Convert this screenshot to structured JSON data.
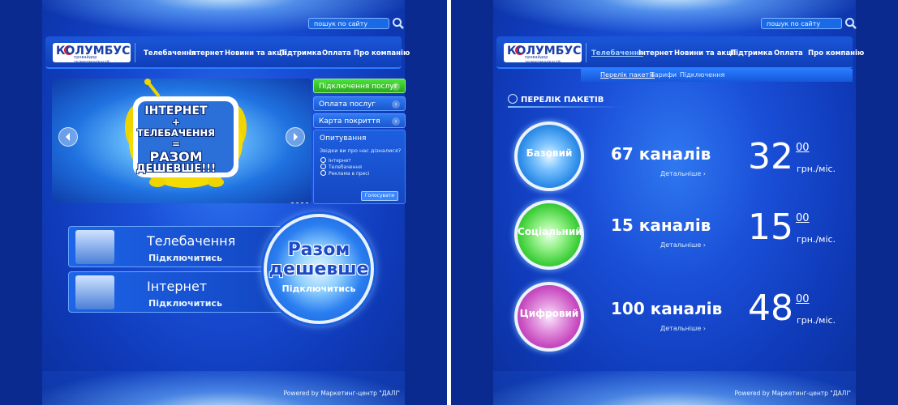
{
  "left": {
    "search_placeholder": "пошук по сайту",
    "logo_text": "КОЛУМБУС",
    "logo_sub": "провайдер телекомунікацій",
    "nav": [
      "Телебачення",
      "Інтернет",
      "Новини та акції",
      "Підтримка",
      "Оплата",
      "Про компанію"
    ],
    "banner": {
      "line1": "ІНТЕРНЕТ",
      "line2": "+",
      "line3": "ТЕЛЕБАЧЕННЯ",
      "line4": "=",
      "line5": "РАЗОМ",
      "line6": "ДЕШЕВШЕ!!!"
    },
    "side_menu": [
      "Підключення послуг",
      "Оплата послуг",
      "Карта покриття"
    ],
    "poll": {
      "title": "Опитування",
      "question": "Звідки ви про нас дізналися?",
      "options": [
        "Інтернет",
        "Телебачення",
        "Реклама в пресі"
      ],
      "button": "Голосувати"
    },
    "cta": [
      {
        "title": "Телебачення",
        "action": "Підключитись"
      },
      {
        "title": "Інтернет",
        "action": "Підключитись"
      }
    ],
    "circle": {
      "line1": "Разом",
      "line2": "дешевше",
      "action": "Підключитись"
    },
    "footer": "Powered by Маркетинг-центр \"ДАЛІ\""
  },
  "right": {
    "search_placeholder": "пошук по сайту",
    "logo_text": "КОЛУМБУС",
    "logo_sub": "провайдер телекомунікацій",
    "nav": [
      "Телебачення",
      "Інтернет",
      "Новини та акції",
      "Підтримка",
      "Оплата",
      "Про компанію"
    ],
    "subnav": [
      "Перелік пакетів",
      "Тарифи",
      "Підключення"
    ],
    "section_title": "ПЕРЕЛІК ПАКЕТІВ",
    "packages": [
      {
        "name": "Базовий",
        "channels": "67 каналів",
        "more": "Детальніше",
        "price": "32",
        "cents": "00",
        "unit": "грн./міс.",
        "color": "#2e8de8"
      },
      {
        "name": "Соціальний",
        "channels": "15 каналів",
        "more": "Детальніше",
        "price": "15",
        "cents": "00",
        "unit": "грн./міс.",
        "color": "#3fcf3a"
      },
      {
        "name": "Цифровий",
        "channels": "100 каналів",
        "more": "Детальніше",
        "price": "48",
        "cents": "00",
        "unit": "грн./міс.",
        "color": "#c84ac0"
      }
    ],
    "footer": "Powered by Маркетинг-центр \"ДАЛІ\""
  },
  "colors": {
    "accent_green": "#37c12a",
    "menu_blue": "#2b6fe6",
    "white": "#ffffff"
  }
}
